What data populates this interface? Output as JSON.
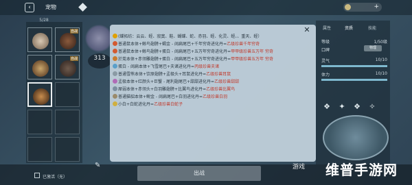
{
  "topbar": {
    "back_icon": "left-arrow-icon",
    "title": "宠物"
  },
  "grid": {
    "count": "5/28",
    "tag": "自战",
    "selected_slot": 2
  },
  "score": {
    "value": "313"
  },
  "info": {
    "lines": [
      {
        "pre": "(",
        "text": "蝶拓纺：",
        "post": "云云、蛭、寂寞、鞋、蝴蝶、蛇、赤羽、蛭、化灵、蛭、、重天、蛭）"
      },
      {
        "pre": "",
        "text": "普通鼠本体+鲸鸟翅膀+蝎金 - 阔扁尾巴+千年穷奇进化丹=",
        "post": "乙级珍兽千年穷奇"
      },
      {
        "pre": "",
        "text": "普通鼠本体+鲸鸟翅膀+蛋白 - 阔扁尾巴+五万年穷奇进化丹=",
        "post": "甲甲级珍兽五万年 穷奇"
      },
      {
        "pre": "",
        "text": "於莵本体+赤翎雕翅膀+蛋白 - 阔扁尾巴+五万年穷奇进化丹=",
        "post": "甲甲级珍兽五万年 穷奇"
      },
      {
        "pre": "",
        "text": "蛋白 - 阔扁本体+飞雪尾巴+夫诸进化丹=",
        "post": "丙级珍兽夫诸"
      },
      {
        "pre": "",
        "text": "普通雪熊本体+饮原翅膀+孟极头+耳鼠进化丹=",
        "post": "乙级珍兽耳鼠"
      },
      {
        "pre": "",
        "text": "孟极本体+红颜头+巨蟹 - 尾利翅尾巴+甜甜进化丹=",
        "post": "乙级珍兽甜甜"
      },
      {
        "pre": "",
        "text": "犀弱本体+赤翎头+白羽雕翅膀+比翼鸟进化丹=",
        "post": "乙级珍兽比翼鸟"
      },
      {
        "pre": "",
        "text": "普通猫貂本体+鲵金 - 阔扁尾巴+白羽进化丹=",
        "post": "乙级珍兽白羽"
      },
      {
        "pre": "",
        "text": "小白+白蛇进化丹=",
        "post": "乙级珍兽白蛇子"
      }
    ]
  },
  "right": {
    "tabs": [
      "属性",
      "资质",
      "技能"
    ],
    "stats": [
      {
        "label": "等级",
        "value": "1/50级"
      },
      {
        "label": "口碑",
        "value": ""
      },
      {
        "label": "灵气",
        "value": "10/10"
      },
      {
        "label": "体力",
        "value": "10/10"
      }
    ],
    "badge": "物理"
  },
  "bottom": {
    "battle_label": "出战",
    "note": "已激活（无）"
  },
  "watermark": {
    "small": "游戏",
    "big": "维普手游网"
  },
  "colors": {
    "accent": "#2e7da8",
    "highlight": "#c0392b",
    "panel": "#c4d4de"
  }
}
